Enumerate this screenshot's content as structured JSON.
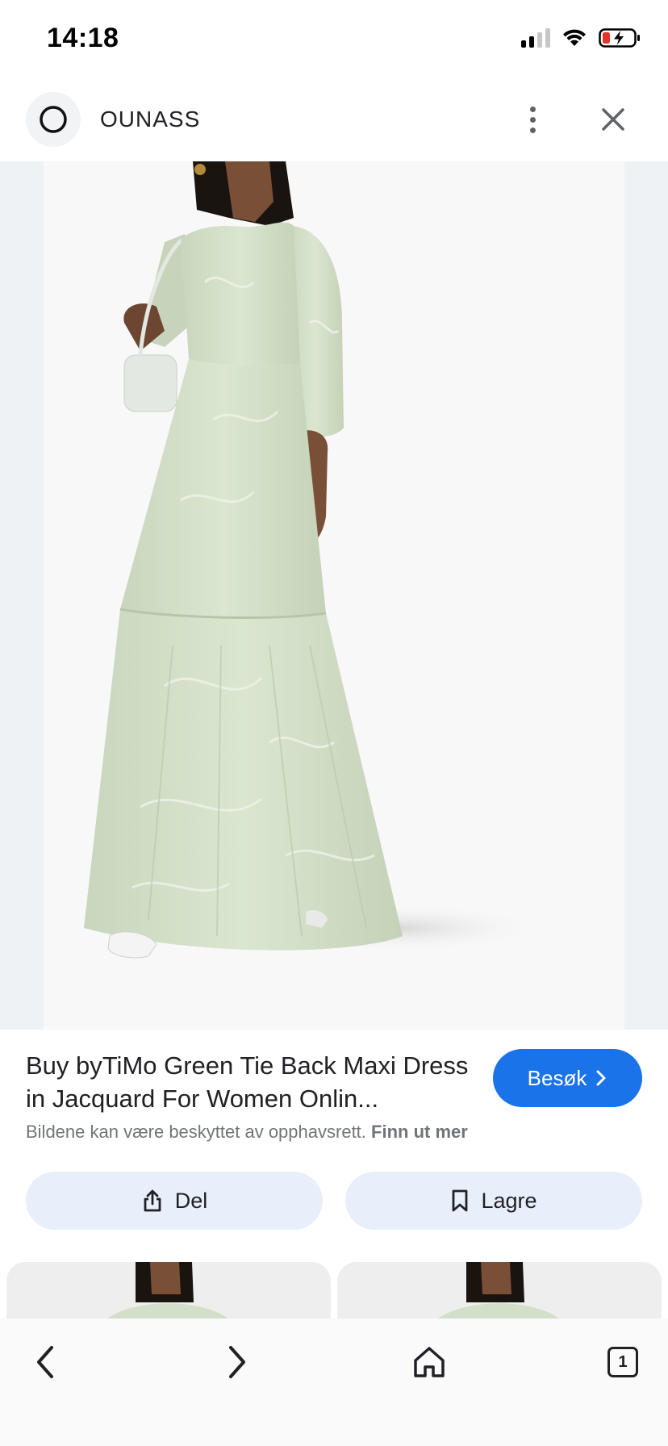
{
  "status_bar": {
    "time": "14:18",
    "icons": [
      "signal-icon",
      "wifi-icon",
      "battery-charging-icon"
    ],
    "battery_low_color": "#e5342b"
  },
  "header": {
    "site_name": "OUNASS",
    "logo_icon": "ounass-ring-icon",
    "menu_icon": "more-vert-icon",
    "close_icon": "close-icon"
  },
  "product": {
    "title": "Buy byTiMo Green Tie Back Maxi Dress in Jacquard For Women Onlin...",
    "visit_label": "Besøk",
    "copyright_text": "Bildene kan være beskyttet av opphavsrett.",
    "learn_more_label": "Finn ut mer",
    "dress_color": "#d3dfc8"
  },
  "actions": {
    "share_label": "Del",
    "save_label": "Lagre"
  },
  "bottom_nav": {
    "tab_count": "1"
  },
  "colors": {
    "accent": "#1a73e8",
    "action_bg": "#e8effa"
  }
}
